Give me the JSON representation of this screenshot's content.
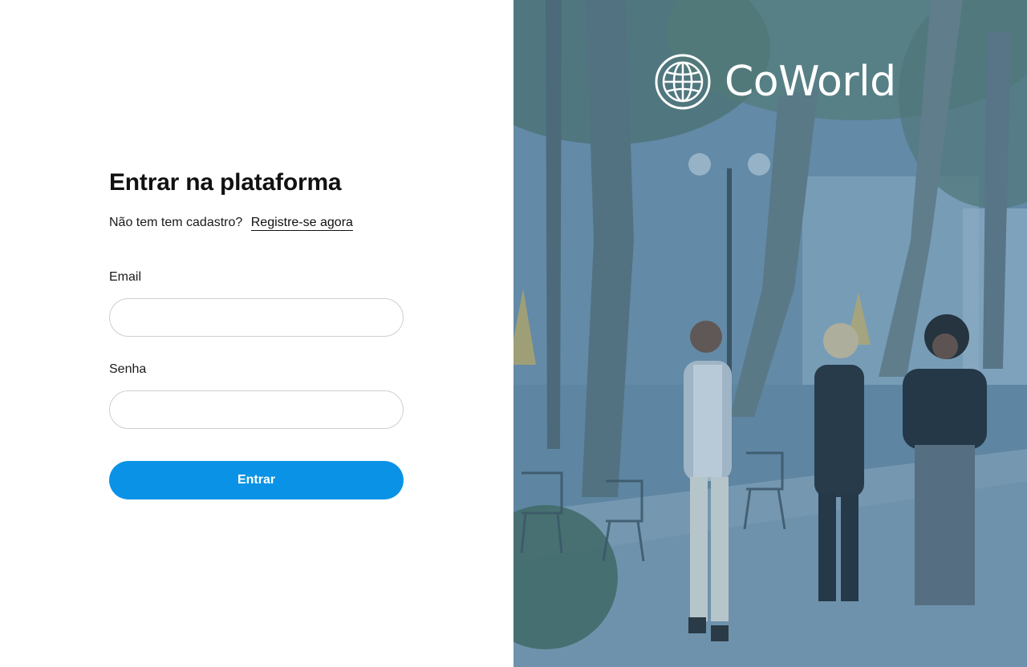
{
  "login": {
    "title": "Entrar na plataforma",
    "no_account_text": "Não tem tem cadastro?",
    "register_link": "Registre-se agora",
    "email_label": "Email",
    "email_value": "",
    "password_label": "Senha",
    "password_value": "",
    "submit_label": "Entrar"
  },
  "brand": {
    "name": "CoWorld",
    "icon": "globe-icon"
  },
  "colors": {
    "primary_button": "#0a93e6",
    "photo_tint": "#5f86a3"
  }
}
